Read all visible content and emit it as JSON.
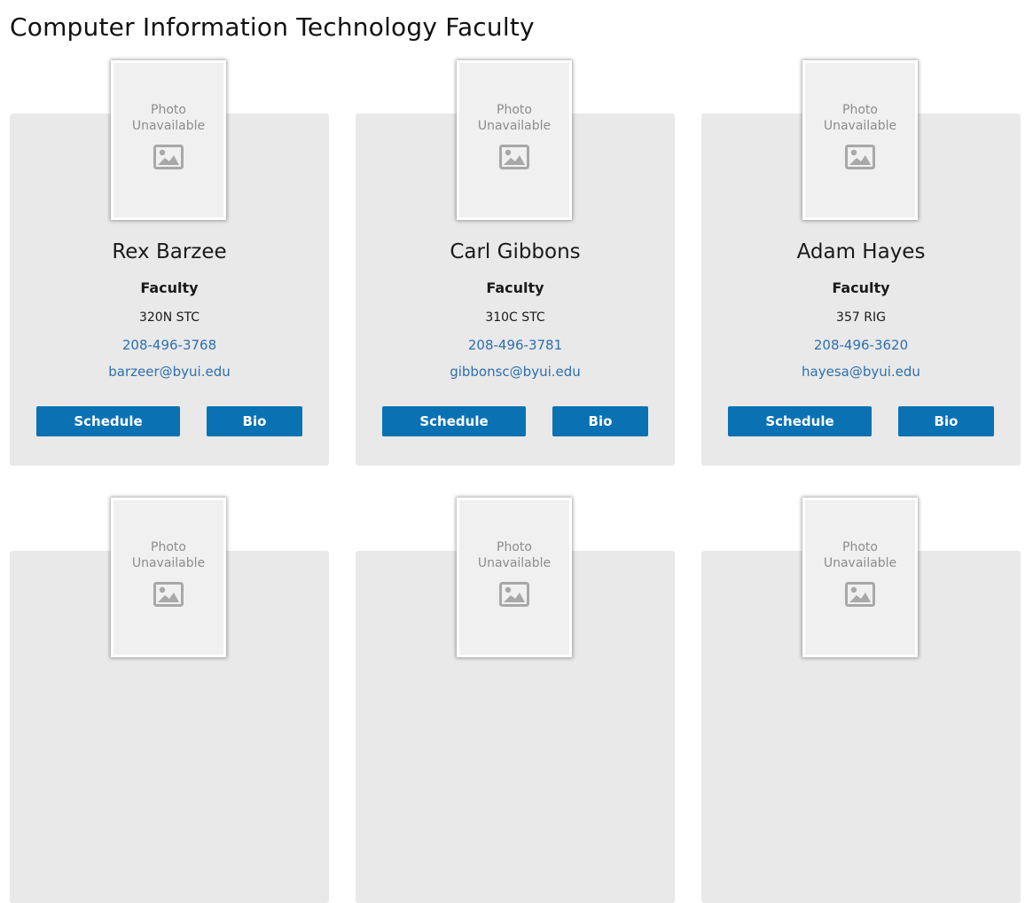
{
  "page": {
    "title": "Computer Information Technology Faculty"
  },
  "photo_placeholder": {
    "line1": "Photo",
    "line2": "Unavailable",
    "icon": "image-icon"
  },
  "faculty": [
    {
      "name": "Rex Barzee",
      "role": "Faculty",
      "office": "320N STC",
      "phone": "208-496-3768",
      "email": "barzeer@byui.edu",
      "schedule_label": "Schedule",
      "bio_label": "Bio"
    },
    {
      "name": "Carl Gibbons",
      "role": "Faculty",
      "office": "310C STC",
      "phone": "208-496-3781",
      "email": "gibbonsc@byui.edu",
      "schedule_label": "Schedule",
      "bio_label": "Bio"
    },
    {
      "name": "Adam Hayes",
      "role": "Faculty",
      "office": "357 RIG",
      "phone": "208-496-3620",
      "email": "hayesa@byui.edu",
      "schedule_label": "Schedule",
      "bio_label": "Bio"
    }
  ],
  "colors": {
    "button": "#0a72b3",
    "link": "#2d6fb0",
    "card": "#e9e9e9"
  }
}
